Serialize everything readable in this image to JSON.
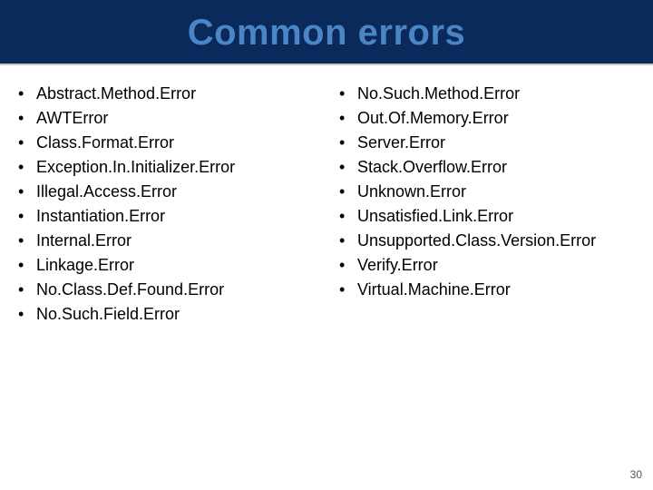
{
  "title": "Common errors",
  "columns": {
    "left": [
      "Abstract.Method.Error",
      "AWTError",
      "Class.Format.Error",
      "Exception.In.Initializer.Error",
      "Illegal.Access.Error",
      "Instantiation.Error",
      "Internal.Error",
      "Linkage.Error",
      "No.Class.Def.Found.Error",
      "No.Such.Field.Error"
    ],
    "right": [
      "No.Such.Method.Error",
      "Out.Of.Memory.Error",
      "Server.Error",
      "Stack.Overflow.Error",
      "Unknown.Error",
      "Unsatisfied.Link.Error",
      "Unsupported.Class.Version.Error",
      "Verify.Error",
      "Virtual.Machine.Error"
    ]
  },
  "page_number": "30"
}
